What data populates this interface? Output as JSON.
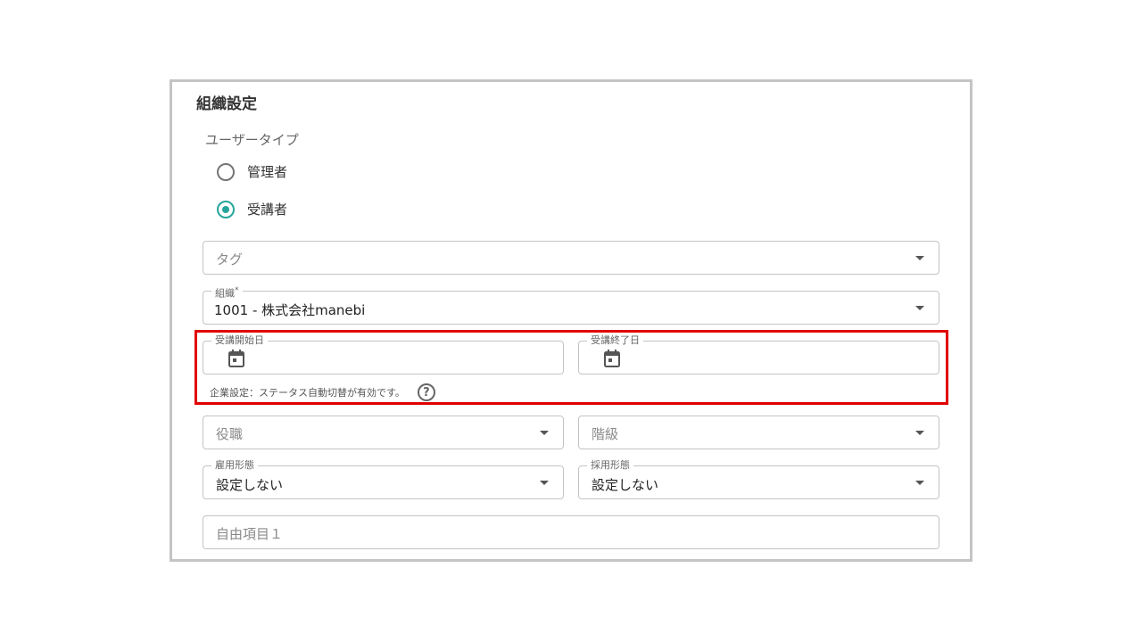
{
  "section": {
    "title": "組織設定"
  },
  "user_type": {
    "label": "ユーザータイプ",
    "options": [
      {
        "label": "管理者",
        "selected": false
      },
      {
        "label": "受講者",
        "selected": true
      }
    ]
  },
  "fields": {
    "tag": {
      "placeholder": "タグ"
    },
    "organization": {
      "label": "組織",
      "required_mark": "*",
      "value": "1001 - 株式会社manebi"
    },
    "start_date": {
      "label": "受講開始日"
    },
    "end_date": {
      "label": "受講終了日"
    },
    "position": {
      "placeholder": "役職"
    },
    "rank": {
      "placeholder": "階級"
    },
    "employment_type": {
      "label": "雇用形態",
      "value": "設定しない"
    },
    "hiring_type": {
      "label": "採用形態",
      "value": "設定しない"
    },
    "free_item_1": {
      "placeholder": "自由項目１"
    }
  },
  "note": {
    "text": "企業設定：ステータス自動切替が有効です。",
    "help_glyph": "?"
  },
  "colors": {
    "accent": "#26a69a",
    "highlight": "#e00000",
    "border": "#c4c4c4"
  },
  "icons": [
    "calendar-icon",
    "help-circle-icon",
    "dropdown-arrow-icon"
  ]
}
